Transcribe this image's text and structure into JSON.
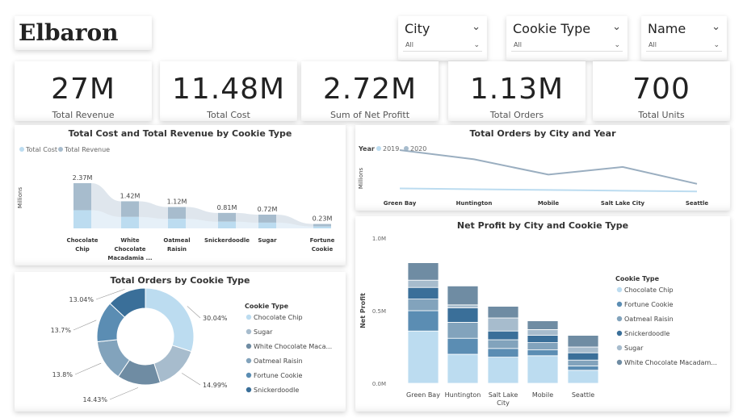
{
  "brand": {
    "name": "Elbaron"
  },
  "slicers": [
    {
      "title": "City",
      "value": "All"
    },
    {
      "title": "Cookie Type",
      "value": "All"
    },
    {
      "title": "Name",
      "value": "All"
    }
  ],
  "kpis": [
    {
      "value": "27M",
      "label": "Total Revenue"
    },
    {
      "value": "11.48M",
      "label": "Total Cost"
    },
    {
      "value": "2.72M",
      "label": "Sum of Net Profitt"
    },
    {
      "value": "1.13M",
      "label": "Total Orders"
    },
    {
      "value": "700",
      "label": "Total Units"
    }
  ],
  "colors": {
    "light": "#bcdcf0",
    "mid": "#a7bccd",
    "dark": "#6f8ca3",
    "steel": "#5b8db3",
    "navy": "#3a6f99"
  },
  "chart_data": [
    {
      "type": "area",
      "title": "Total Cost and Total Revenue by Cookie Type",
      "ylabel": "Millions",
      "categories": [
        "Chocolate Chip",
        "White Chocolate Macadamia ...",
        "Oatmeal Raisin",
        "Snickerdoodle",
        "Sugar",
        "Fortune Cookie"
      ],
      "category_lines": [
        [
          "Chocolate",
          "Chip"
        ],
        [
          "White",
          "Chocolate",
          "Macadamia ..."
        ],
        [
          "Oatmeal",
          "Raisin"
        ],
        [
          "Snickerdoodle"
        ],
        [
          "Sugar"
        ],
        [
          "Fortune",
          "Cookie"
        ]
      ],
      "legend": [
        "Total Cost",
        "Total Revenue"
      ],
      "series": [
        {
          "name": "Total Cost",
          "values": [
            0.95,
            0.6,
            0.5,
            0.35,
            0.3,
            0.1
          ]
        },
        {
          "name": "Total Revenue",
          "values": [
            2.37,
            1.42,
            1.12,
            0.81,
            0.72,
            0.23
          ]
        }
      ],
      "data_labels": [
        "2.37M",
        "1.42M",
        "1.12M",
        "0.81M",
        "0.72M",
        "0.23M"
      ]
    },
    {
      "type": "line",
      "title": "Total Orders by City and Year",
      "ylabel": "Millions",
      "legend_title": "Year",
      "categories": [
        "Green Bay",
        "Huntington",
        "Mobile",
        "Salt Lake City",
        "Seattle"
      ],
      "series": [
        {
          "name": "2019",
          "values": [
            0.05,
            0.045,
            0.04,
            0.035,
            0.03
          ]
        },
        {
          "name": "2020",
          "values": [
            0.3,
            0.24,
            0.14,
            0.19,
            0.08
          ]
        }
      ]
    },
    {
      "type": "pie",
      "title": "Total Orders by Cookie Type",
      "legend_title": "Cookie Type",
      "labels": [
        "Chocolate Chip",
        "Sugar",
        "White Chocolate Maca...",
        "Oatmeal Raisin",
        "Fortune Cookie",
        "Snickerdoodle"
      ],
      "values": [
        30.04,
        14.99,
        14.43,
        13.8,
        13.7,
        13.04
      ],
      "pct_labels": [
        "30.04%",
        "14.99%",
        "14.43%",
        "13.8%",
        "13.7%",
        "13.04%"
      ]
    },
    {
      "type": "bar",
      "title": "Net Profit by City and Cookie Type",
      "ylabel": "Net Profit",
      "yticks": [
        "0.0M",
        "0.5M",
        "1.0M"
      ],
      "ylim": [
        0,
        1.0
      ],
      "legend_title": "Cookie Type",
      "categories": [
        "Green Bay",
        "Huntington",
        "Salt Lake City",
        "Mobile",
        "Seattle"
      ],
      "category_lines": [
        [
          "Green Bay"
        ],
        [
          "Huntington"
        ],
        [
          "Salt Lake",
          "City"
        ],
        [
          "Mobile"
        ],
        [
          "Seattle"
        ]
      ],
      "series": [
        {
          "name": "Chocolate Chip",
          "values": [
            0.36,
            0.2,
            0.18,
            0.19,
            0.09
          ]
        },
        {
          "name": "Fortune Cookie",
          "values": [
            0.14,
            0.11,
            0.06,
            0.04,
            0.03
          ]
        },
        {
          "name": "Oatmeal Raisin",
          "values": [
            0.08,
            0.11,
            0.06,
            0.05,
            0.04
          ]
        },
        {
          "name": "Snickerdoodle",
          "values": [
            0.08,
            0.1,
            0.06,
            0.05,
            0.05
          ]
        },
        {
          "name": "Sugar",
          "values": [
            0.05,
            0.02,
            0.09,
            0.04,
            0.04
          ]
        },
        {
          "name": "White Chocolate Macadam...",
          "values": [
            0.12,
            0.13,
            0.08,
            0.06,
            0.08
          ]
        }
      ]
    }
  ]
}
